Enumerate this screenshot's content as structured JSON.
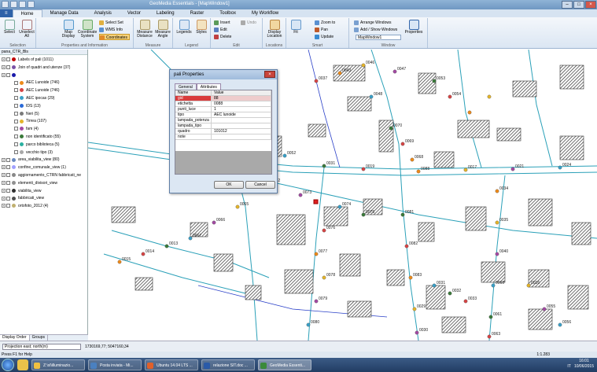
{
  "window": {
    "title": "GeoMedia Essentials - [MapWindow1]"
  },
  "ribbon_tabs": [
    "Home",
    "Manage Data",
    "Analysis",
    "Vector",
    "Labeling",
    "Raster",
    "Toolbox",
    "My Workflow"
  ],
  "file_tab": "",
  "ribbon": {
    "selection": {
      "select": "Select",
      "unselect": "Unselect All",
      "group": "Selection"
    },
    "props": {
      "select_set": "Select Set",
      "wms_info": "WMS Info",
      "coordinates": "Coordinates",
      "map_display": "Map Display",
      "coord_system": "Coordinate System",
      "group": "Properties and Information"
    },
    "measure": {
      "distance": "Measure Distance",
      "angle": "Measure Angle",
      "group": "Measure"
    },
    "legend": {
      "legends": "Legends",
      "styles": "Styles",
      "group": "Legend"
    },
    "edit": {
      "insert": "Insert",
      "edit": "Edit",
      "delete": "Delete",
      "undo": "Undo",
      "group": "Edit"
    },
    "locations": {
      "display": "Display Location",
      "group": "Locations"
    },
    "smart": {
      "fit": "Fit",
      "zoom": "Zoom to",
      "pan": "Pan",
      "update": "Update",
      "group": "Smart"
    },
    "window": {
      "arrange": "Arrange Windows",
      "add_show": "Add / Show Windows",
      "current": "MapWindow1",
      "properties": "Properties",
      "group": "Window"
    }
  },
  "legend": {
    "header": "pana_CTR_Bls",
    "items": [
      {
        "label": "Labels of pali (1011)",
        "color": "#c00000"
      },
      {
        "label": "Join of quadri and utenze (37)",
        "color": "#7a52a6"
      },
      {
        "label": "",
        "color": "#1a1aaa"
      },
      {
        "label": "AEC Lunoide (746)",
        "color": "#ee8a1a"
      },
      {
        "label": "AEC Lunoide (746)",
        "color": "#d64545"
      },
      {
        "label": "AEC ipocas (29)",
        "color": "#3aa0c8"
      },
      {
        "label": "IDS (13)",
        "color": "#2a6ad8"
      },
      {
        "label": "Neri (5)",
        "color": "#7a7a7a"
      },
      {
        "label": "Tirrea (107)",
        "color": "#e4b42a"
      },
      {
        "label": "fam (4)",
        "color": "#a34aa3"
      },
      {
        "label": "non identificato (55)",
        "color": "#3a7a3a"
      },
      {
        "label": "parco biblioteca (5)",
        "color": "#2ab0a0"
      },
      {
        "label": "vecchio tipo (3)",
        "color": "#a8a8a8"
      },
      {
        "label": "area_viabilita_view (80)",
        "color": "#6a8ac0"
      },
      {
        "label": "confine_comunale_view (1)",
        "color": "#a0a0ff"
      },
      {
        "label": "aggiornamento_CTRN fabbricati_ne",
        "color": "#888888"
      },
      {
        "label": "elementi_divisori_view",
        "color": "#909090"
      },
      {
        "label": "viabilita_view",
        "color": "#303030"
      },
      {
        "label": "fabbricati_view",
        "color": "#505050"
      },
      {
        "label": "ortofoto_2012 (4)",
        "color": "#c0b070"
      }
    ],
    "tabs": [
      "Display Order",
      "Groups"
    ]
  },
  "dialog": {
    "title": "pali Properties",
    "tabs": [
      "General",
      "Attributes"
    ],
    "columns": [
      "Name",
      "Value"
    ],
    "rows": [
      {
        "name": "gid",
        "value": "88"
      },
      {
        "name": "etichetta",
        "value": "0088"
      },
      {
        "name": "punti_luce",
        "value": "1"
      },
      {
        "name": "tipo",
        "value": "AEC lunoide"
      },
      {
        "name": "lampada_potenza",
        "value": ""
      },
      {
        "name": "lampada_tipo",
        "value": ""
      },
      {
        "name": "quadro",
        "value": "101012"
      },
      {
        "name": "note",
        "value": ""
      }
    ],
    "ok": "OK",
    "cancel": "Cancel"
  },
  "map_labels": [
    "0045",
    "0089",
    "0062",
    "0052",
    "0031",
    "0019",
    "0088",
    "0017",
    "0021",
    "0024",
    "0036",
    "0037",
    "0043",
    "0046",
    "0047",
    "0048",
    "0070",
    "0069",
    "0068",
    "0072",
    "0073",
    "0074",
    "0075",
    "0076",
    "0077",
    "0078",
    "0079",
    "0080",
    "0081",
    "0082",
    "0083",
    "0029",
    "0030",
    "0031",
    "0032",
    "0033",
    "0034",
    "0035",
    "0040",
    "0060",
    "0061",
    "0063",
    "0064",
    "0065",
    "0066",
    "0067",
    "0013",
    "0014",
    "0015",
    "0016",
    "0055",
    "0056",
    "0053",
    "0054"
  ],
  "command": {
    "projection": "Projection east; north(m)",
    "coords": "1730169,77; 5047160,34"
  },
  "status": {
    "help": "Press F1 for Help",
    "scale": "1:1.283"
  },
  "taskbar": {
    "items": [
      {
        "label": "Z:\\xl\\illuminazio...",
        "color": "#f0c040"
      },
      {
        "label": "Posta inviata - Mi...",
        "color": "#4a80c0"
      },
      {
        "label": "Ubuntu 14.04 LTS ...",
        "color": "#e0602a"
      },
      {
        "label": "relazione SIT.doc ...",
        "color": "#2a5aa8"
      },
      {
        "label": "GeoMedia Essenti...",
        "color": "#3a8a3a"
      }
    ],
    "tray_lang": "IT",
    "time": "16:01",
    "date": "10/06/2015"
  }
}
